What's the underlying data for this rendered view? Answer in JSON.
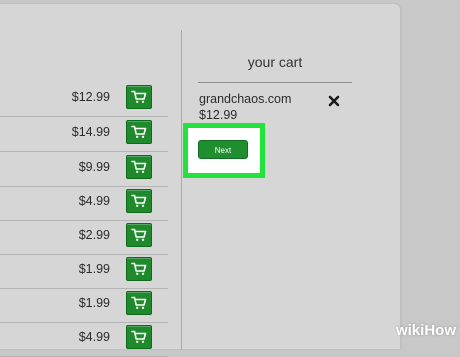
{
  "colors": {
    "accent_green": "#1f8e2e",
    "highlight_green": "#22e33c"
  },
  "products": {
    "prices": [
      "$12.99",
      "$14.99",
      "$9.99",
      "$4.99",
      "$2.99",
      "$1.99",
      "$1.99",
      "$4.99"
    ],
    "button_icon": "cart-icon"
  },
  "cart": {
    "title": "your cart",
    "item": {
      "name": "grandchaos.com",
      "price": "$12.99",
      "remove_icon": "close-x-icon"
    },
    "next_label": "Next"
  },
  "watermark": {
    "part1": "wiki",
    "part2": "How"
  }
}
